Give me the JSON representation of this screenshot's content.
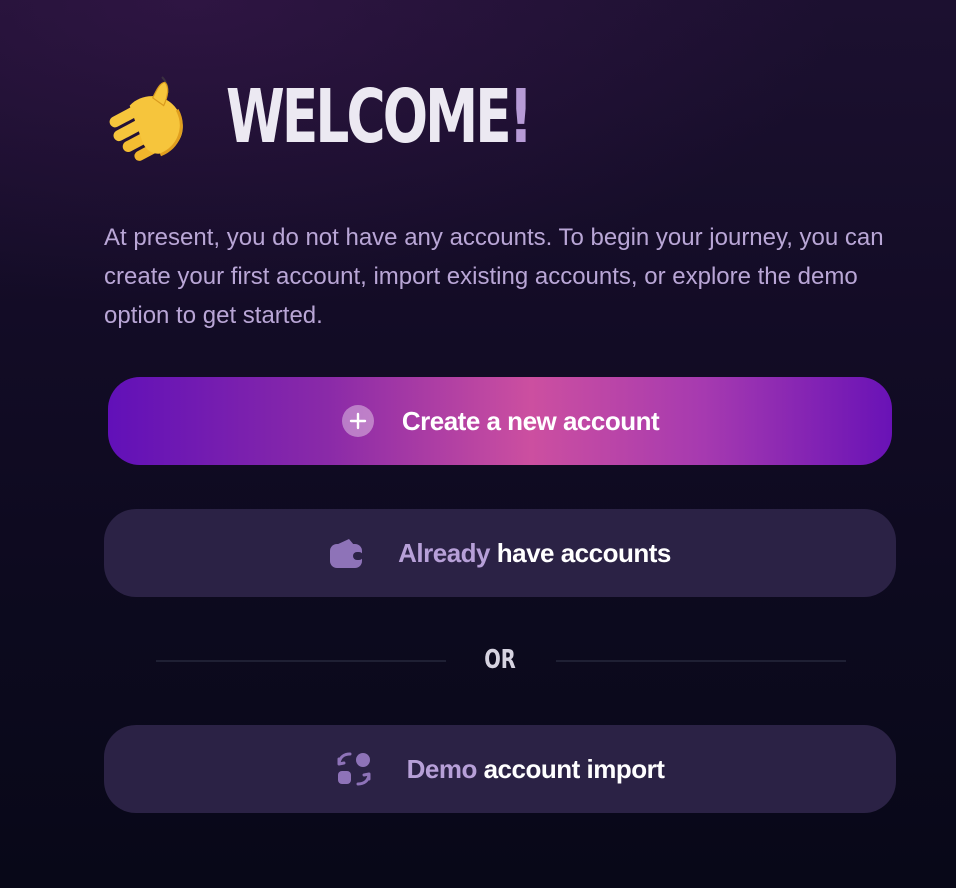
{
  "welcome": {
    "icon": "waving-hand-icon",
    "title": "WELCOME",
    "exclamation": "!"
  },
  "intro_text": "At present, you do not have any accounts. To begin your journey, you can create your first account, import existing accounts, or explore the demo option to get started.",
  "actions": {
    "create": {
      "icon": "plus-circle-icon",
      "label": "Create a new account"
    },
    "already": {
      "icon": "wallet-icon",
      "label_muted": "Already",
      "label_strong": "have accounts"
    },
    "divider": {
      "label": "OR"
    },
    "demo": {
      "icon": "scan-import-icon",
      "label_muted": "Demo",
      "label_strong": "account import"
    }
  },
  "colors": {
    "background_top": "#1c1030",
    "background_bottom": "#080818",
    "text_muted": "#b7a0d8",
    "button_secondary": "#2b2245",
    "gradient_start": "#6110b8",
    "gradient_mid": "#cc4fa0"
  }
}
